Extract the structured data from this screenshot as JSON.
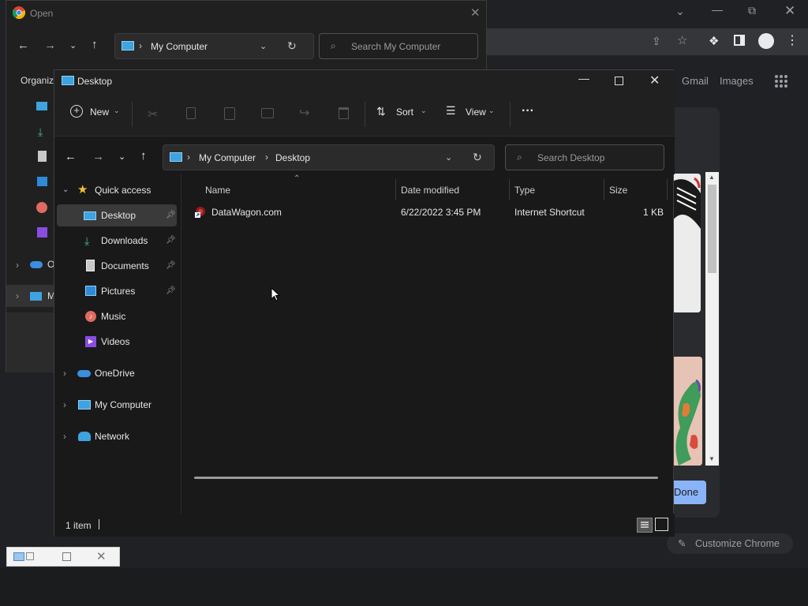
{
  "chrome": {
    "links": [
      "Gmail",
      "Images"
    ],
    "done_label": "Done",
    "customize_label": "Customize Chrome"
  },
  "open_dialog": {
    "title": "Open",
    "address": "My Computer",
    "search_placeholder": "Search My Computer",
    "organize_label": "Organize",
    "side_partial": [
      "O",
      "M"
    ]
  },
  "explorer": {
    "title": "Desktop",
    "toolbar": {
      "new_label": "New",
      "sort_label": "Sort",
      "view_label": "View",
      "more_label": "···"
    },
    "breadcrumb": [
      "My Computer",
      "Desktop"
    ],
    "search_placeholder": "Search Desktop",
    "sidebar": {
      "quick_access": "Quick access",
      "pinned": [
        "Desktop",
        "Downloads",
        "Documents",
        "Pictures"
      ],
      "unpinned": [
        "Music",
        "Videos"
      ],
      "roots": [
        "OneDrive",
        "My Computer",
        "Network"
      ]
    },
    "columns": [
      "Name",
      "Date modified",
      "Type",
      "Size"
    ],
    "files": [
      {
        "name": "DataWagon.com",
        "date": "6/22/2022 3:45 PM",
        "type": "Internet Shortcut",
        "size": "1 KB"
      }
    ],
    "status": "1 item"
  }
}
